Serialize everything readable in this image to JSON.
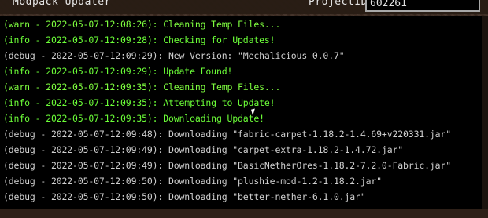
{
  "window": {
    "title": "Modpack Updater",
    "project_id_label": "ProjectID",
    "project_id_value": "602261"
  },
  "log": [
    {
      "level": "warn",
      "text": "(warn - 2022-05-07-12:08:26): Cleaning Temp Files..."
    },
    {
      "level": "info",
      "text": "(info - 2022-05-07-12:09:28): Checking for Updates!"
    },
    {
      "level": "debug",
      "text": "(debug - 2022-05-07-12:09:29): New Version: \"Mechalicious 0.0.7\""
    },
    {
      "level": "info",
      "text": "(info - 2022-05-07-12:09:29): Update Found!"
    },
    {
      "level": "warn",
      "text": "(warn - 2022-05-07-12:09:35): Cleaning Temp Files..."
    },
    {
      "level": "info",
      "text": "(info - 2022-05-07-12:09:35): Attempting to Update!"
    },
    {
      "level": "info",
      "text": "(info - 2022-05-07-12:09:35): Downloading Update!"
    },
    {
      "level": "debug",
      "text": "(debug - 2022-05-07-12:09:48): Downloading \"fabric-carpet-1.18.2-1.4.69+v220331.jar\""
    },
    {
      "level": "debug",
      "text": "(debug - 2022-05-07-12:09:49): Downloading \"carpet-extra-1.18.2-1.4.72.jar\""
    },
    {
      "level": "debug",
      "text": "(debug - 2022-05-07-12:09:49): Downloading \"BasicNetherOres-1.18.2-7.2.0-Fabric.jar\""
    },
    {
      "level": "debug",
      "text": "(debug - 2022-05-07-12:09:50): Downloading \"plushie-mod-1.2-1.18.2.jar\""
    },
    {
      "level": "debug",
      "text": "(debug - 2022-05-07-12:09:50): Downloading \"better-nether-6.1.0.jar\""
    }
  ],
  "colors": {
    "warn": "#7fff3f",
    "info": "#6cff38",
    "debug": "#cfcfcf"
  }
}
